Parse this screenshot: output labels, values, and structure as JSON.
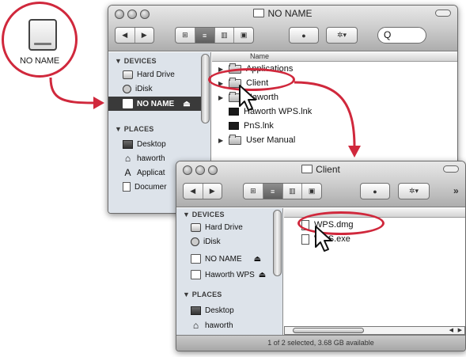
{
  "drive_callout": {
    "label": "NO NAME",
    "icon": "drive-icon"
  },
  "window1": {
    "title": "NO NAME",
    "toolbar": {
      "back": "◀",
      "forward": "▶",
      "view_icon": "⊞",
      "view_list": "≡",
      "view_column": "▥",
      "view_coverflow": "▣",
      "quicklook": "●",
      "action": "✲▾",
      "search_glyph": "Q"
    },
    "sidebar": {
      "devices_header": "▼ DEVICES",
      "devices": [
        {
          "label": "Hard Drive",
          "icon": "hard-drive-icon"
        },
        {
          "label": "iDisk",
          "icon": "idisk-icon"
        },
        {
          "label": "NO NAME",
          "icon": "volume-icon",
          "eject": "⏏",
          "selected": true
        }
      ],
      "places_header": "▼ PLACES",
      "places": [
        {
          "label": "Desktop",
          "icon": "desktop-icon"
        },
        {
          "label": "haworth",
          "icon": "home-icon"
        },
        {
          "label": "Applicat",
          "icon": "applications-icon"
        },
        {
          "label": "Documer",
          "icon": "documents-icon"
        }
      ]
    },
    "column_header": "Name",
    "files": [
      {
        "name": "Applications",
        "kind": "folder",
        "disclosure": "▶"
      },
      {
        "name": "Client",
        "kind": "folder",
        "disclosure": "▶",
        "highlighted": true
      },
      {
        "name": "Haworth",
        "kind": "folder",
        "disclosure": "▶"
      },
      {
        "name": "Haworth WPS.lnk",
        "kind": "link",
        "disclosure": ""
      },
      {
        "name": "PnS.lnk",
        "kind": "link",
        "disclosure": ""
      },
      {
        "name": "User Manual",
        "kind": "folder",
        "disclosure": "▶"
      }
    ]
  },
  "window2": {
    "title": "Client",
    "toolbar": {
      "back": "◀",
      "forward": "▶",
      "view_icon": "⊞",
      "view_list": "≡",
      "view_column": "▥",
      "view_coverflow": "▣",
      "quicklook": "●",
      "action": "✲▾",
      "overflow": "»"
    },
    "sidebar": {
      "devices_header": "▼ DEVICES",
      "devices": [
        {
          "label": "Hard Drive",
          "icon": "hard-drive-icon"
        },
        {
          "label": "iDisk",
          "icon": "idisk-icon"
        },
        {
          "label": "NO NAME",
          "icon": "volume-icon",
          "eject": "⏏"
        },
        {
          "label": "Haworth WPS",
          "icon": "volume-icon",
          "eject": "⏏"
        }
      ],
      "places_header": "▼ PLACES",
      "places": [
        {
          "label": "Desktop",
          "icon": "desktop-icon"
        },
        {
          "label": "haworth",
          "icon": "home-icon"
        }
      ]
    },
    "files": [
      {
        "name": "WPS.dmg",
        "kind": "file",
        "highlighted": true
      },
      {
        "name": "WPS.exe",
        "kind": "file"
      }
    ],
    "status": "1 of 2 selected, 3.68 GB available"
  },
  "colors": {
    "highlight_red": "#d0283c",
    "sidebar_bg": "#dde3ea",
    "selection_dark": "#3a3a3a"
  }
}
